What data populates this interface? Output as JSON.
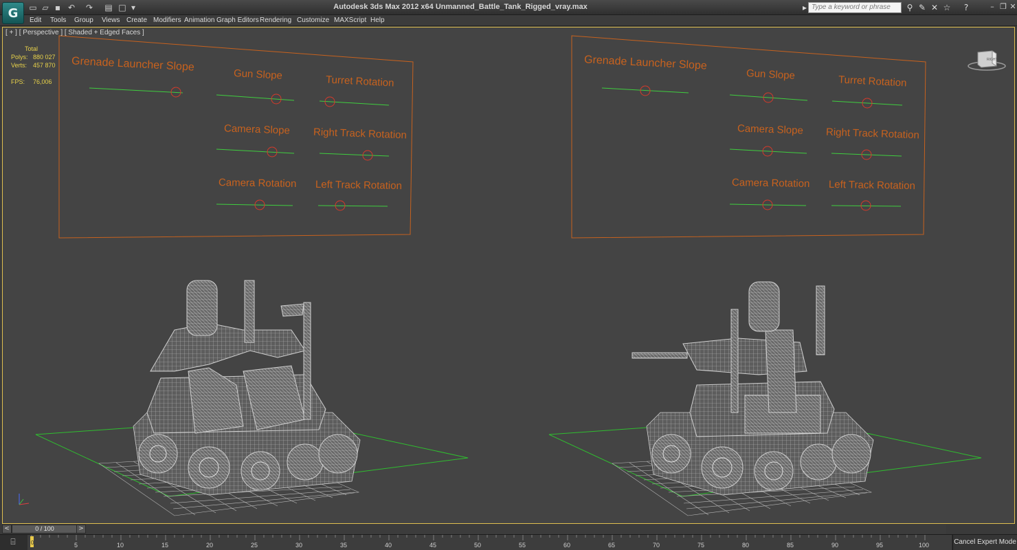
{
  "window": {
    "title": "Autodesk 3ds Max  2012 x64      Unmanned_Battle_Tank_Rigged_vray.max",
    "search_placeholder": "Type a keyword or phrase",
    "logo_glyph": "G"
  },
  "quick_access": [
    "new-icon",
    "open-icon",
    "save-icon",
    "undo-icon",
    "redo-icon",
    "project-folder-icon",
    "window-icon"
  ],
  "menu": [
    "Edit",
    "Tools",
    "Group",
    "Views",
    "Create",
    "Modifiers",
    "Animation",
    "Graph Editors",
    "Rendering",
    "Customize",
    "MAXScript",
    "Help"
  ],
  "viewport": {
    "label": "[ + ] [ Perspective ] [ Shaded + Edged Faces ]",
    "stats": {
      "total_label": "Total",
      "polys_label": "Polys:",
      "polys_value": "880 027",
      "verts_label": "Verts:",
      "verts_value": "457 870",
      "fps_label": "FPS:",
      "fps_value": "76,006"
    },
    "viewcube_label": "RIGHT",
    "control_panels": [
      {
        "labels": [
          "Grenade Launcher Slope",
          "Gun Slope",
          "Turret Rotation",
          "Camera Slope",
          "Right Track Rotation",
          "Camera Rotation",
          "Left Track Rotation"
        ]
      },
      {
        "labels": [
          "Grenade Launcher Slope",
          "Gun Slope",
          "Turret Rotation",
          "Camera Slope",
          "Right Track Rotation",
          "Camera Rotation",
          "Left Track Rotation"
        ]
      }
    ],
    "colors": {
      "panel_text": "#c8621e",
      "panel_border": "#c8621e",
      "slider_line": "#3fcf3f",
      "slider_knob": "#d83a2a",
      "wireframe": "#c8c8c8",
      "ground_green": "#2fbf2f",
      "viewport_bg": "#444444"
    }
  },
  "timeline": {
    "frame_display": "0 / 100",
    "prev_label": "<",
    "next_label": ">",
    "ticks": [
      "0",
      "5",
      "10",
      "15",
      "20",
      "25",
      "30",
      "35",
      "40",
      "45",
      "50",
      "55",
      "60",
      "65",
      "70",
      "75",
      "80",
      "85",
      "90",
      "95",
      "100"
    ]
  },
  "status": {
    "cancel_expert_label": "Cancel Expert Mode"
  }
}
